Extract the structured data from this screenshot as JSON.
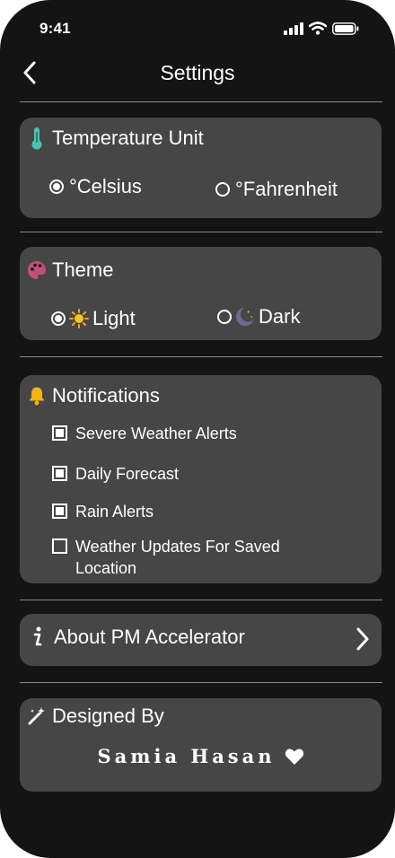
{
  "status_bar": {
    "time": "9:41"
  },
  "header": {
    "title": "Settings"
  },
  "temperature": {
    "title": "Temperature Unit",
    "options": [
      {
        "label": "°Celsius",
        "selected": true
      },
      {
        "label": "°Fahrenheit",
        "selected": false
      }
    ]
  },
  "theme": {
    "title": "Theme",
    "options": [
      {
        "label": "Light",
        "selected": true,
        "icon": "sun-icon"
      },
      {
        "label": "Dark",
        "selected": false,
        "icon": "moon-icon"
      }
    ]
  },
  "notifications": {
    "title": "Notifications",
    "items": [
      {
        "label": "Severe Weather Alerts",
        "checked": true
      },
      {
        "label": "Daily Forecast",
        "checked": true
      },
      {
        "label": "Rain Alerts",
        "checked": true
      },
      {
        "label": "Weather Updates For Saved Location",
        "checked": false
      }
    ]
  },
  "about": {
    "label": "About PM Accelerator"
  },
  "designed": {
    "title": "Designed By",
    "name": "Samia Hasan"
  },
  "colors": {
    "background": "#141414",
    "card": "#464646",
    "thermometer": "#4cc2b0",
    "palette": "#c0507a",
    "bell": "#f2b21c"
  }
}
